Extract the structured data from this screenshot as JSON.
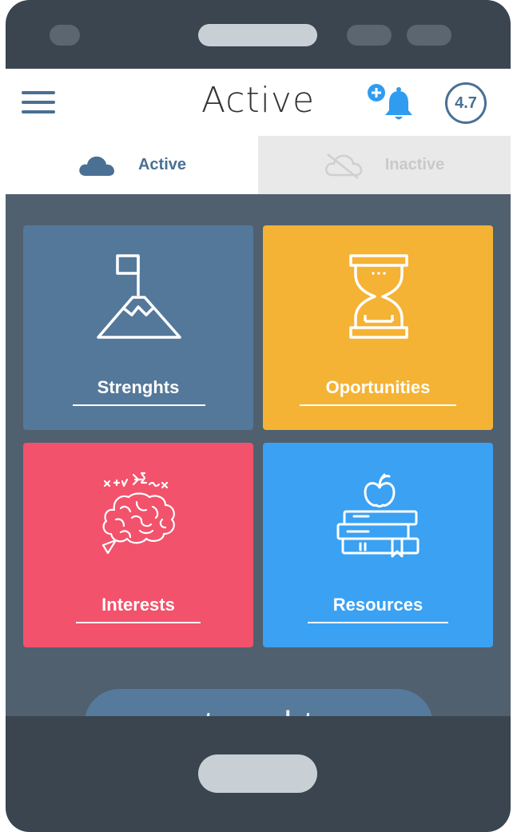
{
  "app": {
    "title": "Active",
    "rating": "4.7"
  },
  "tabs": [
    {
      "label": "Active",
      "state": "selected",
      "icon": "cloud-icon"
    },
    {
      "label": "Inactive",
      "state": "unselected",
      "icon": "cloud-off-icon"
    }
  ],
  "tiles": [
    {
      "label": "Strenghts",
      "color": "#54789a",
      "icon": "mountain-flag-icon"
    },
    {
      "label": "Oportunities",
      "color": "#f4b335",
      "icon": "hourglass-icon"
    },
    {
      "label": "Interests",
      "color": "#f2526b",
      "icon": "brain-icon"
    },
    {
      "label": "Resources",
      "color": "#3aa1f3",
      "icon": "books-apple-icon"
    }
  ],
  "bottom_button": {
    "label": "strenghts"
  },
  "colors": {
    "accent": "#4a7094",
    "screen_bg": "#50606f",
    "notification": "#2f9cf0"
  }
}
